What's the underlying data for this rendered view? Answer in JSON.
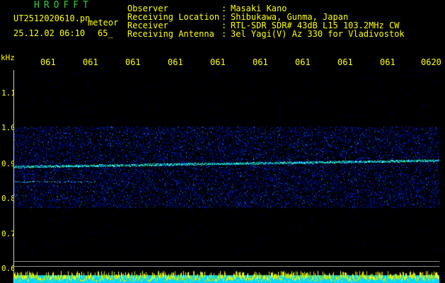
{
  "header": {
    "title": "HROFFT",
    "filename": "UT2512020610.pn",
    "mode": "meteor",
    "datetime": "25.12.02 06:10",
    "level": "65_",
    "fields": [
      {
        "label": "Observer",
        "value": "Masaki Kano"
      },
      {
        "label": "Receiving Location",
        "value": "Shibukawa, Gunma, Japan"
      },
      {
        "label": "Receiver",
        "value": "RTL-SDR SDR# 43dB L15 103.2MHz CW"
      },
      {
        "label": "Receiving Antenna",
        "value": "3el Yagi(V) Az 330 for Vladivostok"
      }
    ]
  },
  "axes": {
    "y_unit": "kHz",
    "y_ticks": [
      "1.1",
      "1.0",
      "0.9",
      "0.8",
      "0.7",
      "0.6"
    ],
    "x_ticks": [
      "061",
      "061",
      "061",
      "061",
      "061",
      "061",
      "061",
      "061",
      "061",
      "0620"
    ]
  },
  "colors": {
    "text": "#ffff00",
    "title": "#33cc33",
    "background": "#000000",
    "noise": "#0000a0",
    "signal": "#00ffff"
  }
}
